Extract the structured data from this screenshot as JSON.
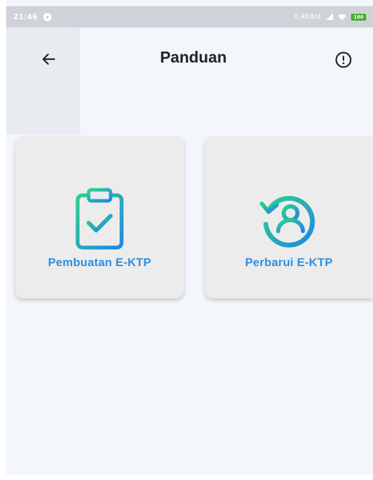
{
  "status_bar": {
    "time": "21:46",
    "speed": "0,4KB/d",
    "battery": "100"
  },
  "app_bar": {
    "title": "Panduan",
    "back_icon": "arrow-left-icon",
    "info_icon": "exclamation-circle-icon"
  },
  "cards": [
    {
      "label": "Pembuatan E-KTP",
      "icon": "clipboard-check-icon"
    },
    {
      "label": "Perbarui E-KTP",
      "icon": "refresh-user-icon"
    }
  ],
  "colors": {
    "accent_text": "#2f8fe0",
    "icon_gradient_start": "#2fd18a",
    "icon_gradient_end": "#1f86e8",
    "card_background": "#ececec",
    "page_background": "#f3f6fb"
  }
}
